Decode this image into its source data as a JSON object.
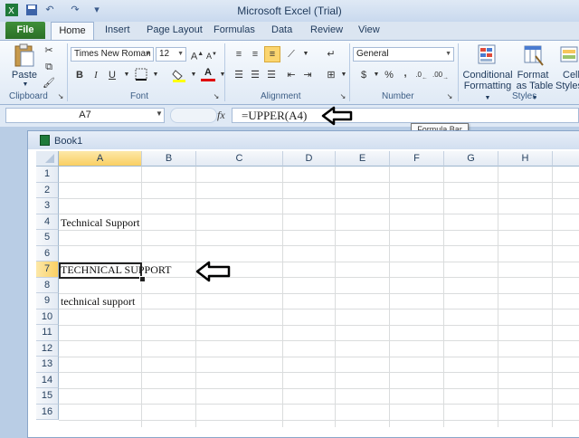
{
  "app": {
    "title": "Microsoft Excel (Trial)"
  },
  "tabs": [
    "File",
    "Home",
    "Insert",
    "Page Layout",
    "Formulas",
    "Data",
    "Review",
    "View"
  ],
  "ribbon": {
    "clipboard": {
      "label": "Clipboard",
      "paste": "Paste"
    },
    "font": {
      "label": "Font",
      "family": "Times New Roman",
      "size": "12"
    },
    "alignment": {
      "label": "Alignment"
    },
    "number": {
      "label": "Number",
      "format": "General",
      "dollar": "$",
      "percent": "%",
      "comma": ","
    },
    "styles": {
      "label": "Styles",
      "conditional_1": "Conditional",
      "conditional_2": "Formatting",
      "format_table_1": "Format",
      "format_table_2": "as Table",
      "cell_styles_1": "Cell",
      "cell_styles_2": "Styles"
    }
  },
  "formula_bar": {
    "name_box": "A7",
    "fx": "fx",
    "formula": "=UPPER(A4)",
    "tooltip": "Formula Bar"
  },
  "workbook": {
    "name": "Book1",
    "columns": [
      "A",
      "B",
      "C",
      "D",
      "E",
      "F",
      "G",
      "H"
    ],
    "rows": [
      "1",
      "2",
      "3",
      "4",
      "5",
      "6",
      "7",
      "8",
      "9",
      "10",
      "11",
      "12",
      "13",
      "14",
      "15",
      "16"
    ],
    "cells": {
      "A4": "Technical Support",
      "A7": "TECHNICAL SUPPORT",
      "A9": "technical support"
    },
    "selected_cell": "A7"
  },
  "colors": {
    "file_tab": "#2a7027",
    "selection": "#f9cf63"
  }
}
